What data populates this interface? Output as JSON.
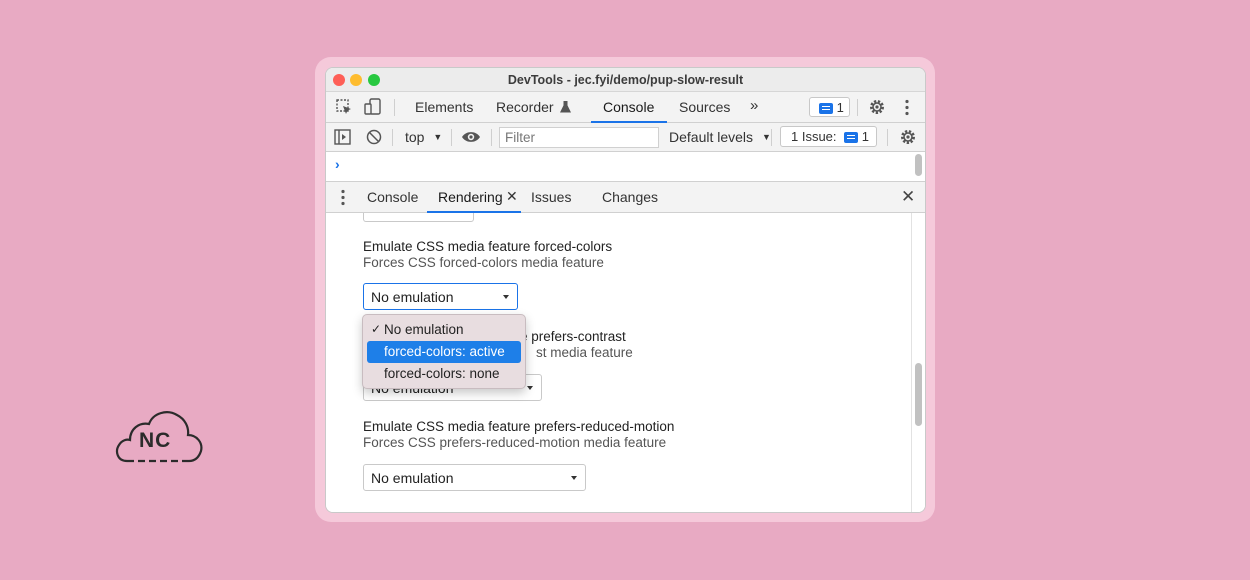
{
  "colors": {
    "background": "#e8aac3",
    "frame": "#f5c9da",
    "accent": "#1a73e8",
    "selection": "#1e7fe8"
  },
  "logo": {
    "text": "NC",
    "icon": "cloud-icon"
  },
  "window": {
    "title": "DevTools - jec.fyi/demo/pup-slow-result"
  },
  "main_tabs": {
    "elements": "Elements",
    "recorder": "Recorder",
    "console": "Console",
    "sources": "Sources",
    "more": "»",
    "issues_count": "1",
    "active": "Console"
  },
  "console_toolbar": {
    "context": "top",
    "filter_placeholder": "Filter",
    "levels": "Default levels",
    "issues_label": "1 Issue:",
    "issues_count": "1"
  },
  "console": {
    "prompt": "›"
  },
  "drawer_tabs": {
    "console": "Console",
    "rendering": "Rendering",
    "issues": "Issues",
    "changes": "Changes",
    "active": "Rendering"
  },
  "rendering": {
    "forced_colors": {
      "title": "Emulate CSS media feature forced-colors",
      "subtitle": "Forces CSS forced-colors media feature",
      "value": "No emulation"
    },
    "prefers_contrast": {
      "title_partial": "e prefers-contrast",
      "subtitle_partial": "st media feature",
      "value": "No emulation"
    },
    "prefers_reduced_motion": {
      "title": "Emulate CSS media feature prefers-reduced-motion",
      "subtitle": "Forces CSS prefers-reduced-motion media feature",
      "value": "No emulation"
    },
    "dropdown": {
      "options": [
        "No emulation",
        "forced-colors: active",
        "forced-colors: none"
      ],
      "checked": "No emulation",
      "highlighted": "forced-colors: active",
      "check_mark": "✓"
    }
  }
}
